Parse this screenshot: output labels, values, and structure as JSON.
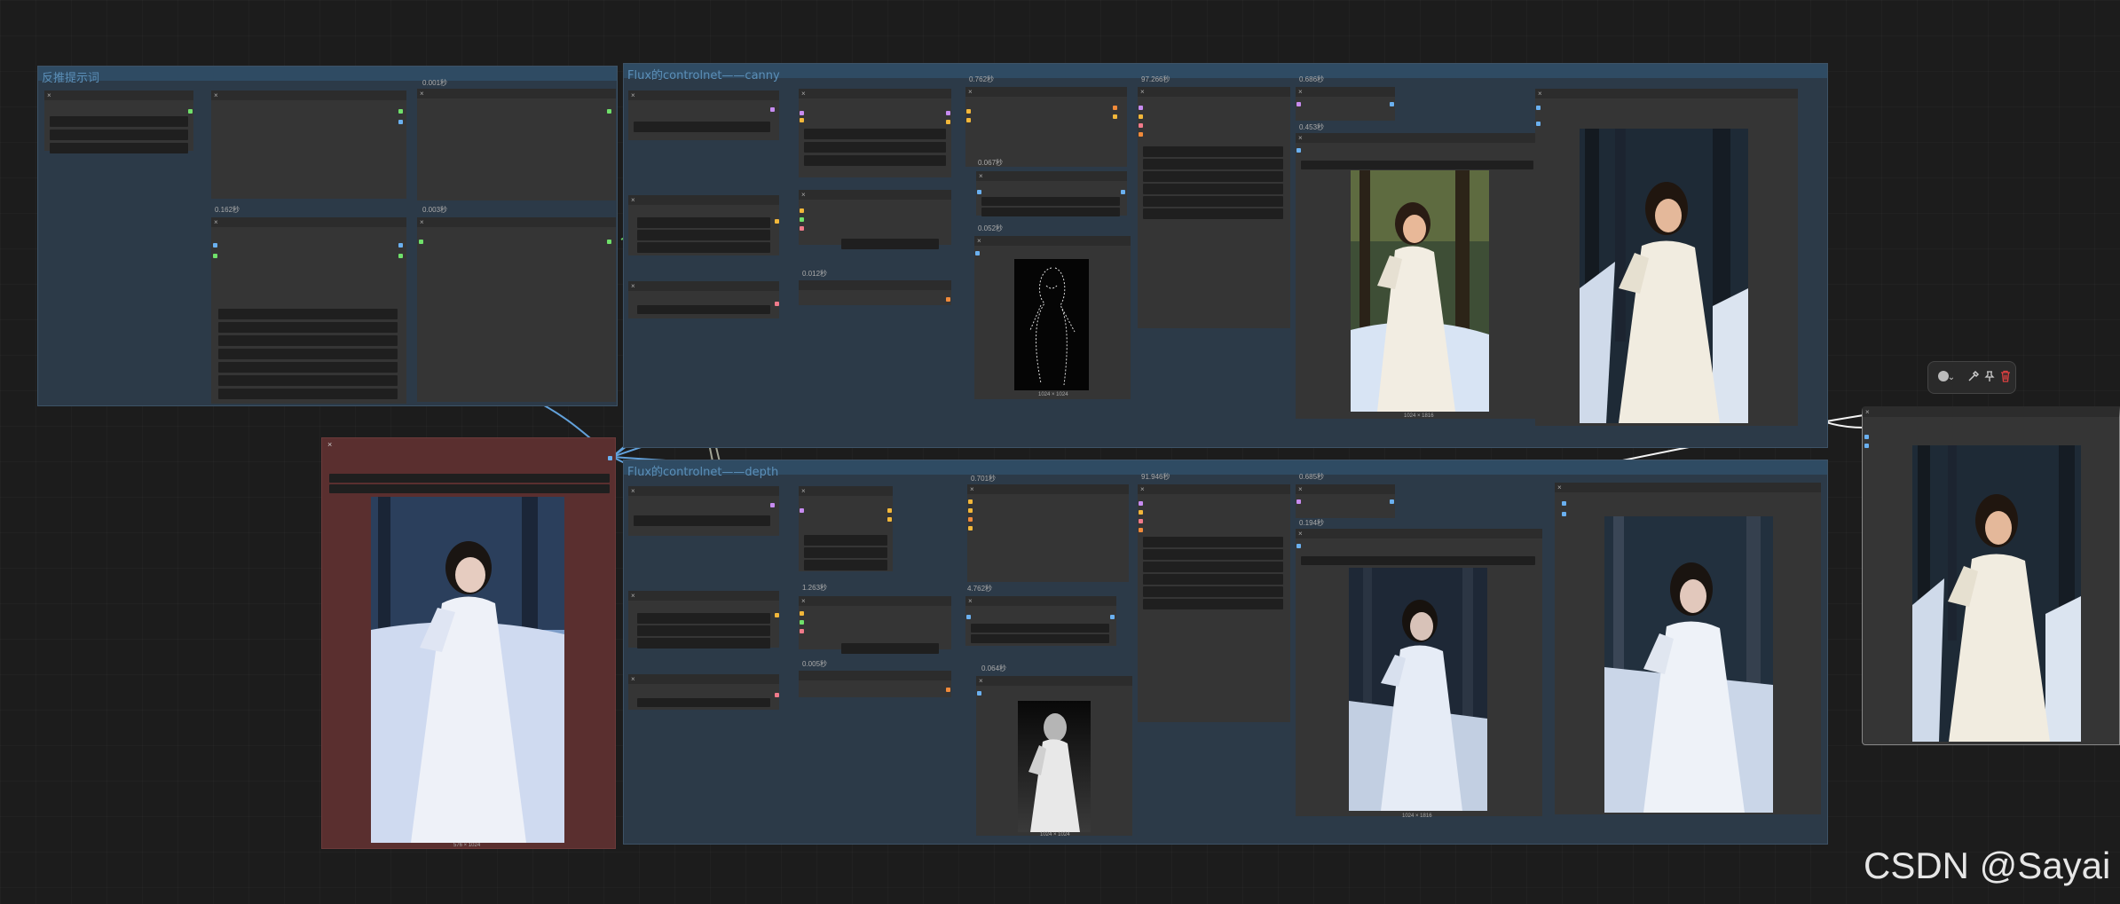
{
  "groups": {
    "left": {
      "title": "反推提示词"
    },
    "canny": {
      "title": "Flux的controlnet——canny"
    },
    "depth": {
      "title": "Flux的controlnet——depth"
    }
  },
  "timings": {
    "l1": "0.001秒",
    "l2": "0.162秒",
    "l3": "0.003秒",
    "c1": "0.762秒",
    "c2": "97.266秒",
    "c3": "0.686秒",
    "c4": "0.067秒",
    "c5": "0.052秒",
    "c6": "0.012秒",
    "c7": "0.453秒",
    "d1": "0.701秒",
    "d2": "91.946秒",
    "d3": "0.685秒",
    "d4": "1.263秒",
    "d5": "4.762秒",
    "d6": "0.064秒",
    "d7": "0.005秒",
    "d8": "0.194秒"
  },
  "resolutions": {
    "canny_edge": "1024 × 1024",
    "canny_out": "1024 × 1816",
    "source": "576 × 1024",
    "depth_map": "1024 × 1024",
    "depth_out": "1024 × 1816"
  },
  "toolbar": {
    "icons": [
      "color-circle-icon",
      "chevron-down-icon",
      "pipette-icon",
      "pin-icon",
      "trash-icon"
    ]
  },
  "colors": {
    "link_blue": "#6ab0f0",
    "link_yellow": "#f2b73a",
    "link_green": "#6fe06a",
    "link_pink": "#f07a8a",
    "link_white": "#ffffff",
    "source_group": "#5a2f2f",
    "delete": "#e04040"
  },
  "watermark": "CSDN @Sayai"
}
